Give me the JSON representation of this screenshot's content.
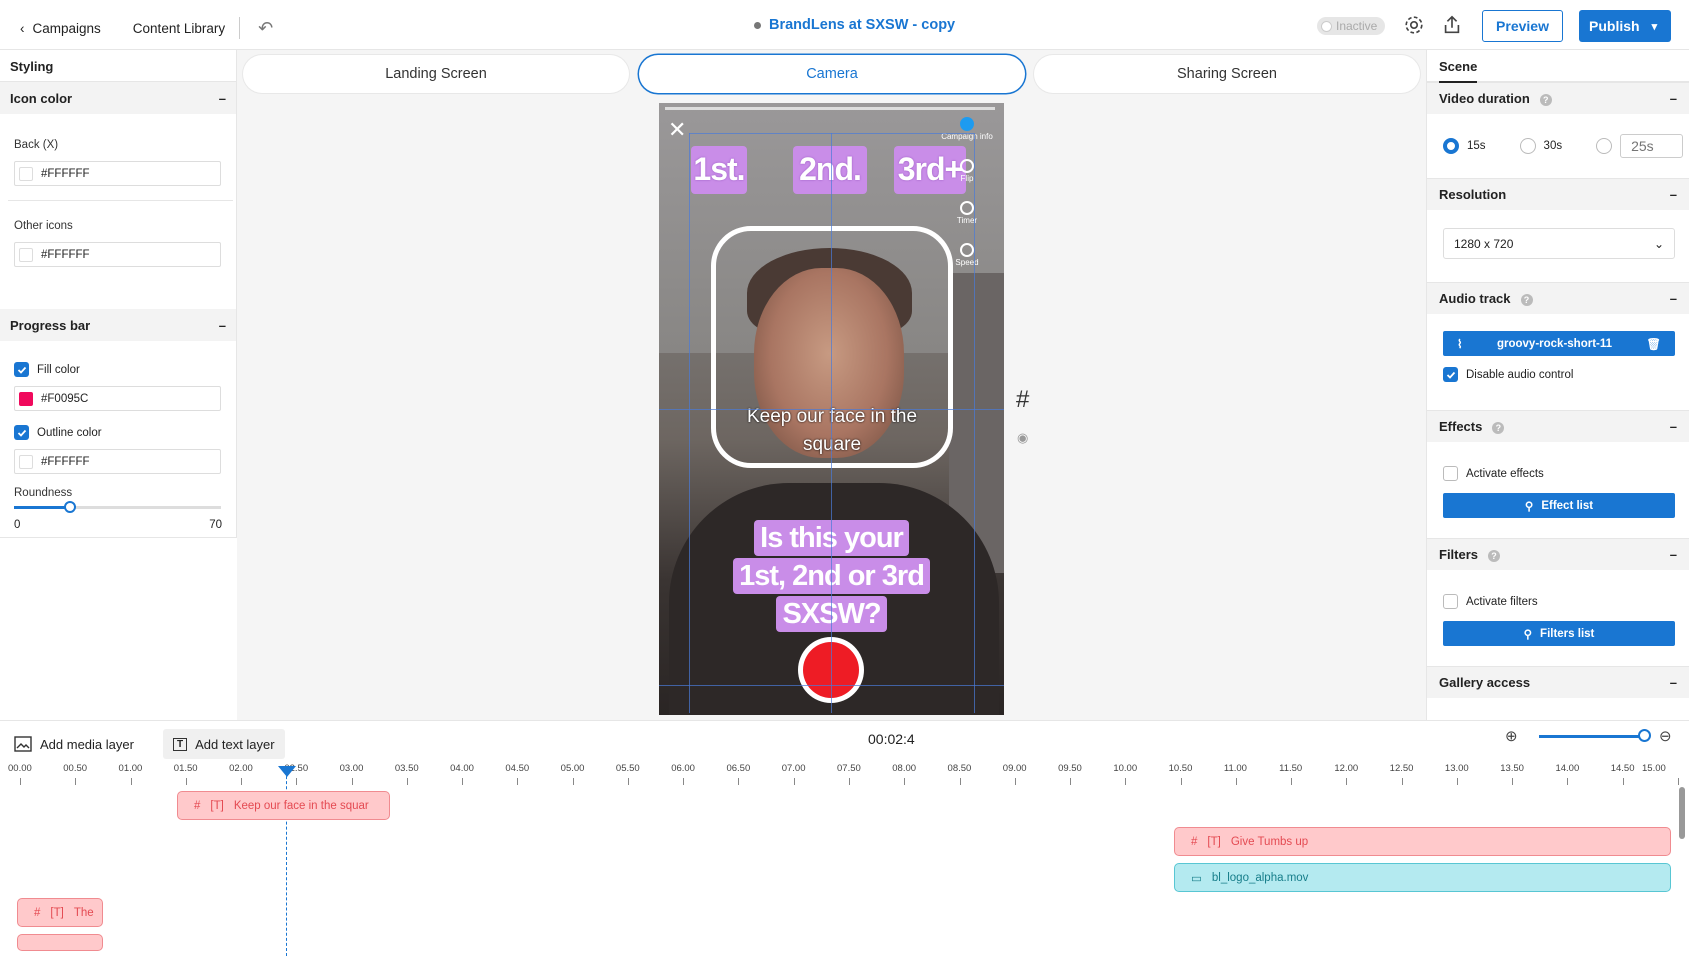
{
  "topbar": {
    "back_label": "Campaigns",
    "content_library": "Content Library",
    "title": "BrandLens at SXSW - copy",
    "status": "Inactive",
    "preview": "Preview",
    "publish": "Publish"
  },
  "left": {
    "header": "Styling",
    "icon_color": {
      "title": "Icon color",
      "back_label": "Back (X)",
      "back_value": "#FFFFFF",
      "other_label": "Other icons",
      "other_value": "#FFFFFF"
    },
    "progress": {
      "title": "Progress bar",
      "fill_label": "Fill color",
      "fill_value": "#F0095C",
      "outline_label": "Outline color",
      "outline_value": "#FFFFFF",
      "roundness_label": "Roundness",
      "roundness_min": "0",
      "roundness_max": "70",
      "roundness_fraction": 0.27
    }
  },
  "tabs": [
    "Landing Screen",
    "Camera",
    "Sharing Screen"
  ],
  "phone": {
    "stickers": [
      "1st.",
      "2nd.",
      "3rd+"
    ],
    "side": [
      "Campaign info",
      "Flip",
      "Timer",
      "Speed"
    ],
    "caption": "Keep our face in the square",
    "question_lines": [
      "Is this your",
      "1st, 2nd or 3rd",
      "SXSW?"
    ]
  },
  "right": {
    "tab": "Scene",
    "video_duration": {
      "title": "Video duration",
      "opt1": "15s",
      "opt2": "30s",
      "custom_placeholder": "25s"
    },
    "resolution": {
      "title": "Resolution",
      "value": "1280 x 720"
    },
    "audio": {
      "title": "Audio track",
      "file": "groovy-rock-short-11",
      "disable": "Disable audio control"
    },
    "effects": {
      "title": "Effects",
      "activate": "Activate effects",
      "list": "Effect list"
    },
    "filters": {
      "title": "Filters",
      "activate": "Activate filters",
      "list": "Filters list"
    },
    "gallery": {
      "title": "Gallery access"
    }
  },
  "timeline": {
    "add_media": "Add media layer",
    "add_text": "Add text layer",
    "current_time": "00:02:4",
    "ticks": [
      "00.00",
      "00.50",
      "01.00",
      "01.50",
      "02.00",
      "02.50",
      "03.00",
      "03.50",
      "04.00",
      "04.50",
      "05.00",
      "05.50",
      "06.00",
      "06.50",
      "07.00",
      "07.50",
      "08.00",
      "08.50",
      "09.00",
      "09.50",
      "10.00",
      "10.50",
      "11.00",
      "11.50",
      "12.00",
      "12.50",
      "13.00",
      "13.50",
      "14.00",
      "14.50",
      "15.00"
    ],
    "layers": {
      "face": "Keep our face in the   squar",
      "tumbs": "Give Tumbs up",
      "logo": "bl_logo_alpha.mov",
      "the": "The"
    }
  }
}
